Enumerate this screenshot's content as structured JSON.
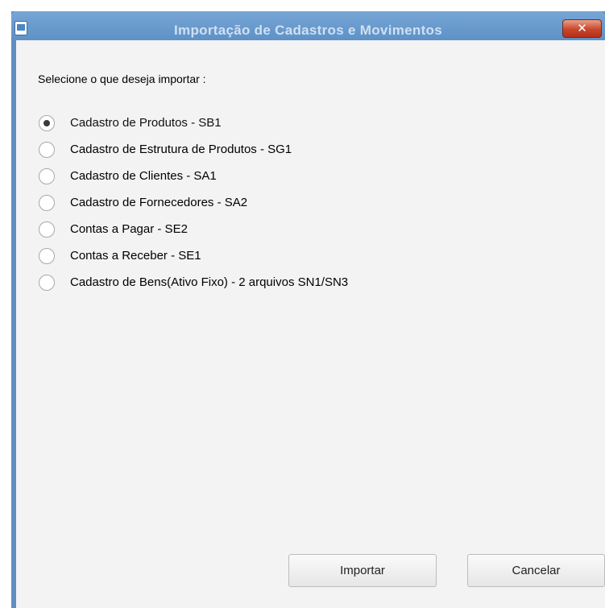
{
  "window": {
    "title": "Importação de Cadastros e Movimentos",
    "close_label": "✕"
  },
  "prompt": "Selecione o que deseja importar :",
  "options": [
    {
      "label": "Cadastro de Produtos - SB1",
      "checked": true
    },
    {
      "label": "Cadastro de Estrutura de Produtos - SG1",
      "checked": false
    },
    {
      "label": "Cadastro de Clientes - SA1",
      "checked": false
    },
    {
      "label": "Cadastro de Fornecedores - SA2",
      "checked": false
    },
    {
      "label": "Contas a Pagar - SE2",
      "checked": false
    },
    {
      "label": "Contas a Receber - SE1",
      "checked": false
    },
    {
      "label": "Cadastro de Bens(Ativo Fixo) - 2 arquivos SN1/SN3",
      "checked": false
    }
  ],
  "buttons": {
    "import_label": "Importar",
    "cancel_label": "Cancelar"
  },
  "colors": {
    "titlebar": "#6a9bcd",
    "close_button": "#c9452b",
    "client_background": "#f3f3f3"
  }
}
